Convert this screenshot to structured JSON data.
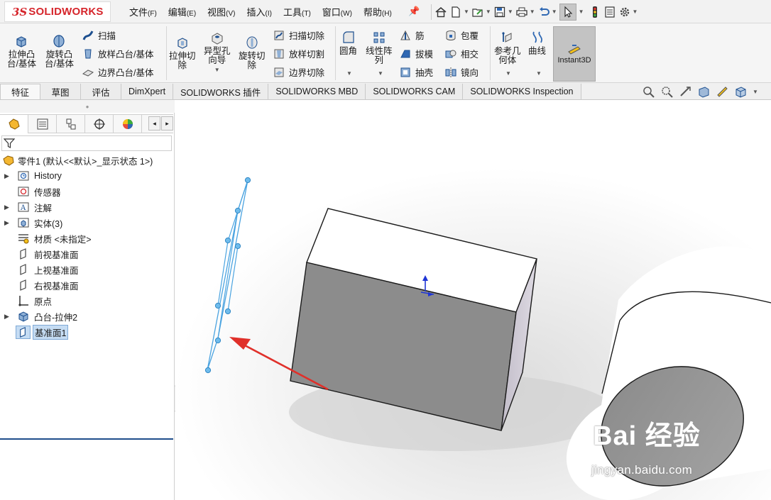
{
  "app": {
    "logo_prefix": "3S",
    "logo_text": "SOLIDWORKS",
    "accent_color": "#d6252b"
  },
  "menu": {
    "items": [
      {
        "label": "文件",
        "key": "(F)"
      },
      {
        "label": "编辑",
        "key": "(E)"
      },
      {
        "label": "视图",
        "key": "(V)"
      },
      {
        "label": "插入",
        "key": "(I)"
      },
      {
        "label": "工具",
        "key": "(T)"
      },
      {
        "label": "窗口",
        "key": "(W)"
      },
      {
        "label": "帮助",
        "key": "(H)"
      }
    ]
  },
  "quickbar": {
    "icons": [
      "home-icon",
      "new-document-icon",
      "open-folder-icon",
      "save-icon",
      "print-icon",
      "undo-icon",
      "select-arrow-icon",
      "rebuild-traffic-light-icon",
      "file-properties-icon",
      "options-gear-icon"
    ]
  },
  "ribbon": {
    "extrude_boss": "拉伸凸\n台/基体",
    "revolve_boss": "旋转凸\n台/基体",
    "sweep": "扫描",
    "loft_boss": "放样凸台/基体",
    "boundary_boss": "边界凸台/基体",
    "extrude_cut": "拉伸切\n除",
    "hole_wizard": "异型孔\n向导",
    "revolve_cut": "旋转切\n除",
    "swept_cut": "扫描切除",
    "lofted_cut": "放样切割",
    "boundary_cut": "边界切除",
    "fillet": "圆角",
    "linear_pattern": "线性阵\n列",
    "rib": "筋",
    "draft": "拔模",
    "shell": "抽壳",
    "wrap": "包覆",
    "intersect": "相交",
    "mirror": "镜向",
    "ref_geometry": "参考几\n何体",
    "curves": "曲线",
    "instant3d": "Instant3D"
  },
  "tabs": [
    "特征",
    "草图",
    "评估",
    "DimXpert",
    "SOLIDWORKS 插件",
    "SOLIDWORKS MBD",
    "SOLIDWORKS CAM",
    "SOLIDWORKS Inspection"
  ],
  "tree": {
    "root": "零件1 (默认<<默认>_显示状态 1>)",
    "nodes": [
      {
        "label": "History",
        "icon": "history-icon",
        "expandable": true
      },
      {
        "label": "传感器",
        "icon": "sensor-icon",
        "expandable": false
      },
      {
        "label": "注解",
        "icon": "annotation-icon",
        "expandable": true
      },
      {
        "label": "实体(3)",
        "icon": "solid-bodies-icon",
        "expandable": true
      },
      {
        "label": "材质 <未指定>",
        "icon": "material-icon",
        "expandable": false
      },
      {
        "label": "前视基准面",
        "icon": "plane-icon",
        "expandable": false
      },
      {
        "label": "上视基准面",
        "icon": "plane-icon",
        "expandable": false
      },
      {
        "label": "右视基准面",
        "icon": "plane-icon",
        "expandable": false
      },
      {
        "label": "原点",
        "icon": "origin-icon",
        "expandable": false
      },
      {
        "label": "凸台-拉伸2",
        "icon": "boss-extrude-icon",
        "expandable": true
      },
      {
        "label": "基准面1",
        "icon": "plane-icon",
        "expandable": false,
        "selected": true
      }
    ]
  },
  "watermark": {
    "main": "Bai 经验",
    "sub": "jingyan.baidu.com"
  }
}
